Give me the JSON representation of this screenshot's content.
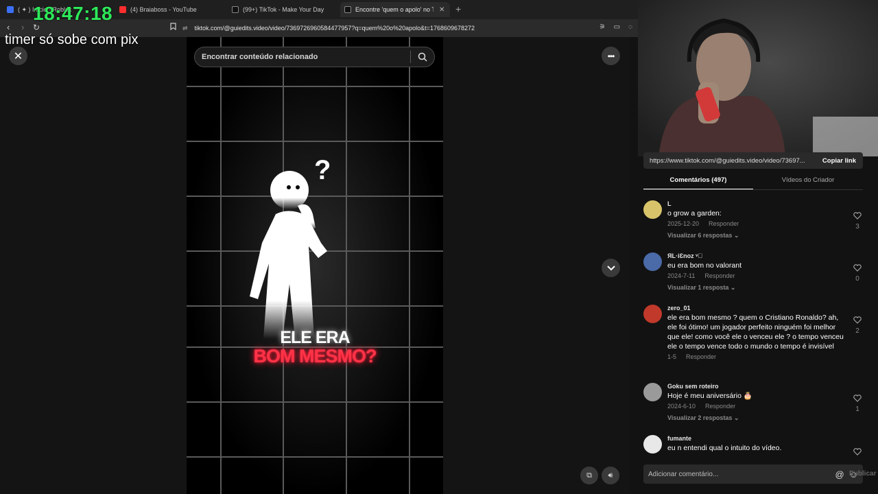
{
  "browser": {
    "tabs": [
      {
        "label": "( ✦ ) Início - Roblox",
        "fav_color": "#3b6ff5"
      },
      {
        "label": "(4) Braiaboss - YouTube",
        "fav_color": "#ff2d2d"
      },
      {
        "label": "(99+) TikTok - Make Your Day",
        "fav_color": "#1f1f1f"
      },
      {
        "label": "Encontre 'quem o apolo' no TikTok",
        "fav_color": "#1f1f1f"
      }
    ],
    "new_tab": "+",
    "url": "tiktok.com/@guiedits.video/video/7369726960584477957?q=quem%20o%20apolo&t=1768609678272"
  },
  "overlay": {
    "clock": "18:47:18",
    "stream_text": "timer só sobe com pix"
  },
  "video": {
    "search_placeholder": "Encontrar conteúdo relacionado",
    "caption_line1": "ELE ERA",
    "caption_line2": "BOM MESMO?"
  },
  "panel": {
    "share_url": "https://www.tiktok.com/@guiedits.video/video/73697...",
    "copy_link": "Copiar link",
    "tab_comments": "Comentários (497)",
    "tab_creator": "Vídeos do Criador",
    "reply_label": "Responder",
    "comments": [
      {
        "user": "L",
        "text": "o grow a garden:",
        "date": "2025-12-20",
        "likes": "3",
        "replies": "Visualizar 6 respostas",
        "avatar_color": "#d8c36a"
      },
      {
        "user": "ЯL·iƐnoz ᵛ⃝",
        "text": "eu era bom no valorant",
        "date": "2024-7-11",
        "likes": "0",
        "replies": "Visualizar 1 resposta",
        "avatar_color": "#4a6aa8"
      },
      {
        "user": "zero_01",
        "text": "ele era bom mesmo ? quem o Cristiano Ronaldo? ah, ele foi ótimo! um jogador perfeito ninguém foi melhor que ele! como você ele o venceu ele ? o tempo venceu ele o tempo vence todo o mundo o tempo é invisível",
        "date": "1-5",
        "likes": "2",
        "replies": "",
        "avatar_color": "#c0392b"
      },
      {
        "user": "Goku sem roteiro",
        "text": "Hoje é meu aniversário 🎂",
        "date": "2024-6-10",
        "likes": "1",
        "replies": "Visualizar 2 respostas",
        "avatar_color": "#9a9a9a"
      },
      {
        "user": "fumante",
        "text": "eu n entendi qual o intuito do vídeo.",
        "date": "",
        "likes": "",
        "replies": "",
        "avatar_color": "#e8e8e8"
      }
    ],
    "input_placeholder": "Adicionar comentário...",
    "publish": "Publicar"
  }
}
